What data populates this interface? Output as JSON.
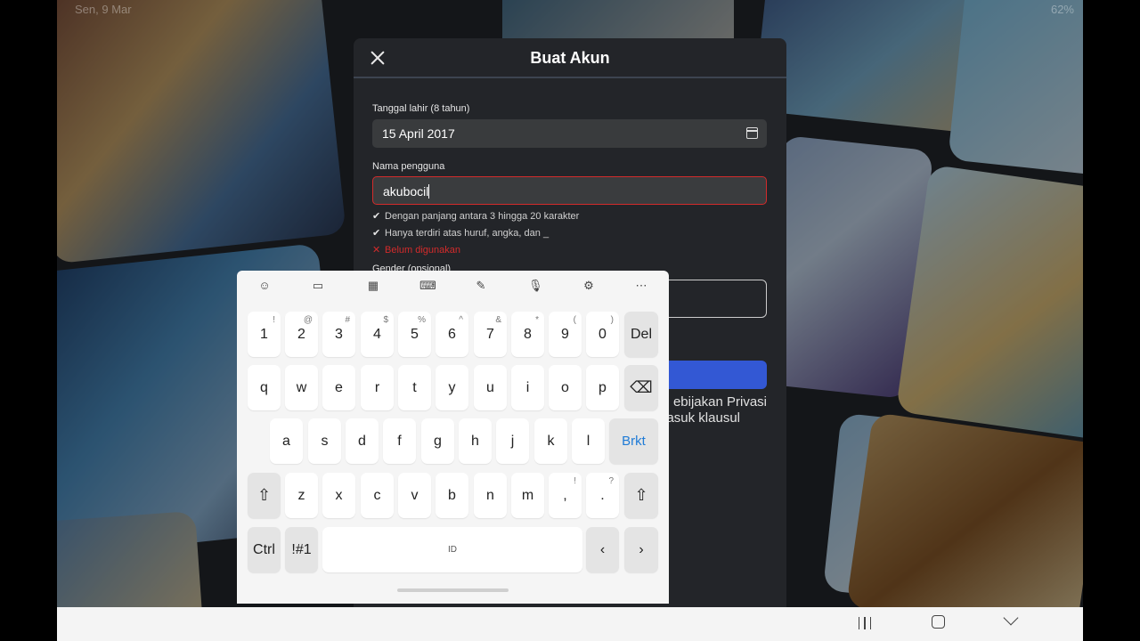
{
  "status": {
    "left": "Sen, 9 Mar",
    "right": "62%"
  },
  "modal": {
    "title": "Buat Akun",
    "birthdate": {
      "label": "Tanggal lahir (8 tahun)",
      "value": "15 April 2017"
    },
    "username": {
      "label": "Nama pengguna",
      "value": "akubocil",
      "rules": [
        {
          "text": "Dengan panjang antara 3 hingga 20 karakter",
          "ok": true
        },
        {
          "text": "Hanya terdiri atas huruf, angka, dan _",
          "ok": true
        },
        {
          "text": "Belum digunakan",
          "ok": false
        }
      ]
    },
    "gender": {
      "label": "Gender (opsional)"
    },
    "terms_line1": "ebijakan Privasi",
    "terms_line2": "asuk klausul"
  },
  "keyboard": {
    "number_row": [
      {
        "key": "1",
        "alt": "!"
      },
      {
        "key": "2",
        "alt": "@"
      },
      {
        "key": "3",
        "alt": "#"
      },
      {
        "key": "4",
        "alt": "$"
      },
      {
        "key": "5",
        "alt": "%"
      },
      {
        "key": "6",
        "alt": "^"
      },
      {
        "key": "7",
        "alt": "&"
      },
      {
        "key": "8",
        "alt": "*"
      },
      {
        "key": "9",
        "alt": "("
      },
      {
        "key": "0",
        "alt": ")"
      }
    ],
    "del_label": "Del",
    "row_q": [
      "q",
      "w",
      "e",
      "r",
      "t",
      "y",
      "u",
      "i",
      "o",
      "p"
    ],
    "row_a": [
      "a",
      "s",
      "d",
      "f",
      "g",
      "h",
      "j",
      "k",
      "l"
    ],
    "enter_label": "Brkt",
    "row_z": [
      "z",
      "x",
      "c",
      "v",
      "b",
      "n",
      "m"
    ],
    "comma": {
      "key": ",",
      "alt": "!"
    },
    "period": {
      "key": ".",
      "alt": "?"
    },
    "ctrl_label": "Ctrl",
    "symbols_label": "!#1",
    "space_label": "ID"
  }
}
